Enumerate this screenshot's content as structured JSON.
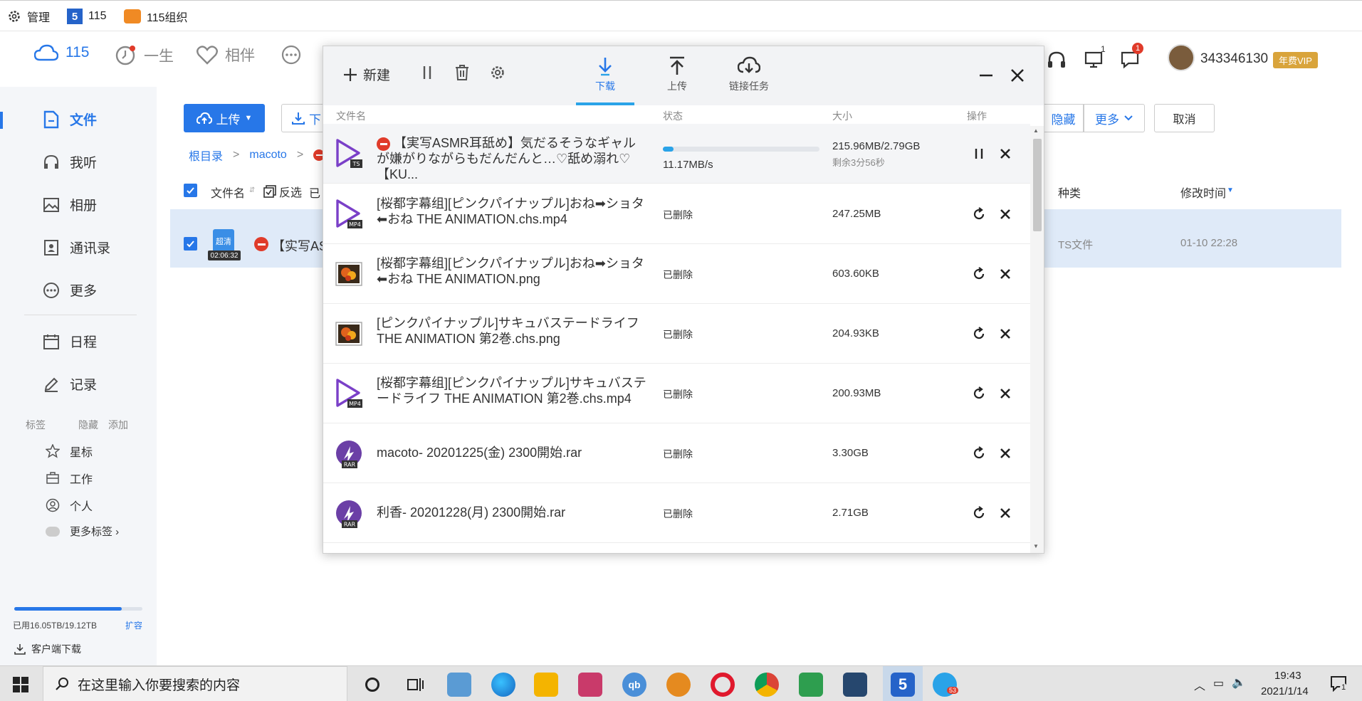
{
  "topbar": {
    "manage": "管理",
    "s115": "115",
    "org": "115组织"
  },
  "header": {
    "nav": [
      {
        "label": "115",
        "icon": "cloud-icon"
      },
      {
        "label": "一生",
        "icon": "clock-icon"
      },
      {
        "label": "相伴",
        "icon": "heart-icon"
      }
    ],
    "monitor_badge": "1",
    "chat_badge": "1",
    "user_id": "343346130",
    "vip": "年费VIP"
  },
  "sidebar": {
    "items": [
      {
        "label": "文件"
      },
      {
        "label": "我听"
      },
      {
        "label": "相册"
      },
      {
        "label": "通讯录"
      },
      {
        "label": "更多"
      },
      {
        "label": "日程"
      },
      {
        "label": "记录"
      }
    ],
    "tag_header": {
      "tags": "标签",
      "hide": "隐藏",
      "add": "添加"
    },
    "tags": [
      {
        "label": "星标"
      },
      {
        "label": "工作"
      },
      {
        "label": "个人"
      },
      {
        "label": "更多标签 ›"
      }
    ],
    "storage": {
      "used": "已用16.05TB/19.12TB",
      "expand": "扩容",
      "fraction": 0.84
    },
    "client_download": "客户端下载"
  },
  "main": {
    "upload": "上传",
    "download_partial": "下",
    "crumbs": [
      "根目录",
      "macoto"
    ],
    "col_name": "文件名",
    "invert": "反选",
    "selected_partial": "已",
    "col_kind": "种类",
    "col_modified": "修改时间",
    "hide_btn": "隐藏",
    "more_btn": "更多",
    "cancel_btn": "取消",
    "row": {
      "name_partial": "【实写AS",
      "thumb_label": "超清",
      "duration": "02:06:32",
      "kind": "TS文件",
      "modified": "01-10 22:28"
    }
  },
  "dialog": {
    "new_label": "新建",
    "tabs": [
      {
        "label": "下载"
      },
      {
        "label": "上传"
      },
      {
        "label": "链接任务"
      }
    ],
    "cols": {
      "name": "文件名",
      "status": "状态",
      "size": "大小",
      "action": "操作"
    },
    "rows": [
      {
        "name": "【実写ASMR耳舐め】気だるそうなギャルが嫌がりながらもだんだんと…♡舐め溺れ♡【KU...",
        "type": "TS",
        "speed": "11.17MB/s",
        "progress": 0.07,
        "size": "215.96MB/2.79GB",
        "remaining": "剩余3分56秒"
      },
      {
        "name": "[桜都字幕组][ピンクパイナップル]おね➡ショタ⬅おね THE ANIMATION.chs.mp4",
        "type": "MP4",
        "status": "已删除",
        "size": "247.25MB"
      },
      {
        "name": "[桜都字幕组][ピンクパイナップル]おね➡ショタ⬅おね THE ANIMATION.png",
        "type": "PNG",
        "status": "已删除",
        "size": "603.60KB"
      },
      {
        "name": "[ピンクパイナップル]サキュバステードライフ THE ANIMATION 第2巻.chs.png",
        "type": "PNG",
        "status": "已删除",
        "size": "204.93KB"
      },
      {
        "name": "[桜都字幕组][ピンクパイナップル]サキュバステードライフ THE ANIMATION 第2巻.chs.mp4",
        "type": "MP4",
        "status": "已删除",
        "size": "200.93MB"
      },
      {
        "name": "macoto- 20201225(金) 2300開始.rar",
        "type": "RAR",
        "status": "已删除",
        "size": "3.30GB"
      },
      {
        "name": "利香- 20201228(月) 2300開始.rar",
        "type": "RAR",
        "status": "已删除",
        "size": "2.71GB"
      }
    ]
  },
  "taskbar": {
    "search_placeholder": "在这里输入你要搜索的内容",
    "time": "19:43",
    "date": "2021/1/14",
    "telegram_badge": "53",
    "notif_badge": "1"
  }
}
